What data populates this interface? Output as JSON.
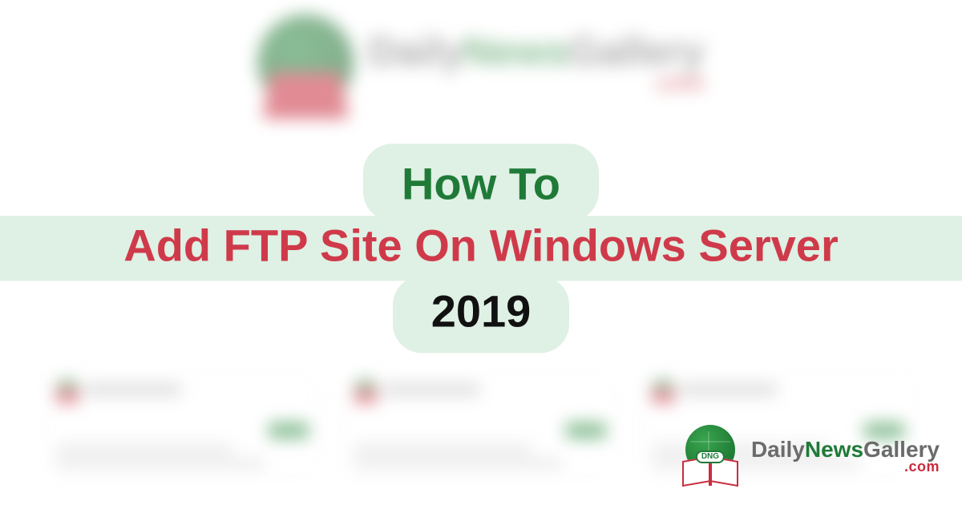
{
  "title": {
    "line1": "How To",
    "line2": "Add FTP Site On Windows Server",
    "line3": "2019"
  },
  "brand": {
    "daily": "Daily",
    "news": "News",
    "gallery": "Gallery",
    "dotcom": ".com",
    "badge": "DNG"
  },
  "colors": {
    "green": "#1f7a38",
    "red": "#cf3a4a",
    "mint": "#dff0e4",
    "black": "#111111"
  }
}
